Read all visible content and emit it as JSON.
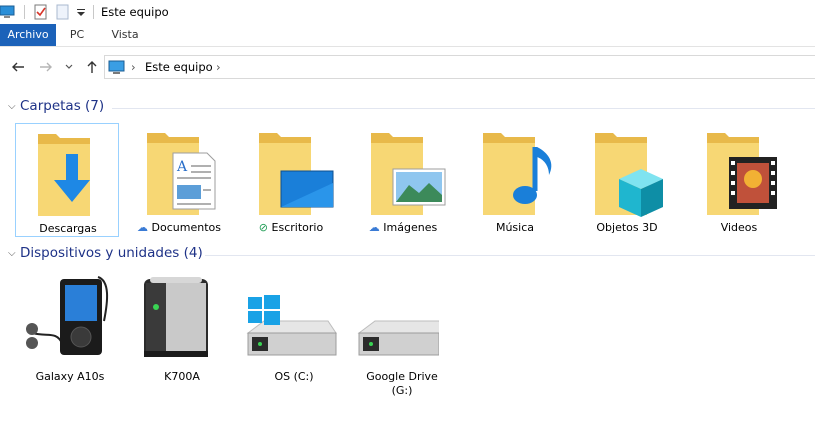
{
  "window": {
    "title": "Este equipo"
  },
  "ribbon": {
    "tabs": [
      {
        "label": "Archivo"
      },
      {
        "label": "PC"
      },
      {
        "label": "Vista"
      }
    ]
  },
  "address": {
    "segments": [
      "Este equipo"
    ]
  },
  "groups": {
    "folders": {
      "title": "Carpetas (7)"
    },
    "devices": {
      "title": "Dispositivos y unidades (4)"
    }
  },
  "folders": [
    {
      "label": "Descargas",
      "status": ""
    },
    {
      "label": "Documentos",
      "status": "cloud"
    },
    {
      "label": "Escritorio",
      "status": "synced"
    },
    {
      "label": "Imágenes",
      "status": "cloud"
    },
    {
      "label": "Música",
      "status": ""
    },
    {
      "label": "Objetos 3D",
      "status": ""
    },
    {
      "label": "Videos",
      "status": ""
    }
  ],
  "devices": [
    {
      "label": "Galaxy A10s",
      "icon": "media-player-icon"
    },
    {
      "label": "K700A",
      "icon": "server-icon"
    },
    {
      "label": "OS (C:)",
      "icon": "windows-drive-icon"
    },
    {
      "label": "Google Drive (G:)",
      "icon": "drive-icon"
    }
  ],
  "colors": {
    "accent": "#1c62b9",
    "group_header": "#1e3287",
    "folder": "#f7d774"
  }
}
